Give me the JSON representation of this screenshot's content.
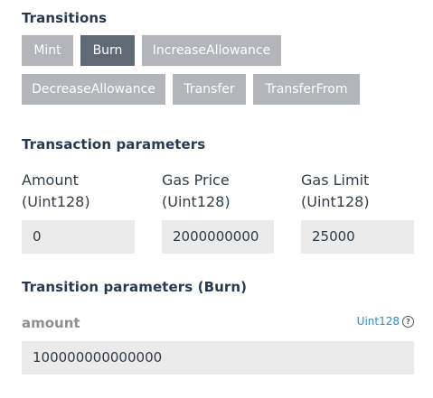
{
  "transitions": {
    "title": "Transitions",
    "buttons": [
      {
        "label": "Mint"
      },
      {
        "label": "Burn"
      },
      {
        "label": "IncreaseAllowance"
      },
      {
        "label": "DecreaseAllowance"
      },
      {
        "label": "Transfer"
      },
      {
        "label": "TransferFrom"
      }
    ],
    "selected": "Burn"
  },
  "tx_params": {
    "title": "Transaction parameters",
    "amount": {
      "label": "Amount",
      "type": "(Uint128)",
      "value": "0"
    },
    "gas_price": {
      "label": "Gas Price",
      "type": "(Uint128)",
      "value": "2000000000"
    },
    "gas_limit": {
      "label": "Gas Limit",
      "type": "(Uint128)",
      "value": "25000"
    }
  },
  "transition_params": {
    "title": "Transition parameters (Burn)",
    "field_label": "amount",
    "field_type": "Uint128",
    "help_icon": "question-circle-icon",
    "field_value": "100000000000000"
  },
  "colors": {
    "button_inactive": "#b2b6ba",
    "button_active": "#5f6a74",
    "link": "#2d8cd1",
    "input_bg": "#ebebeb"
  }
}
